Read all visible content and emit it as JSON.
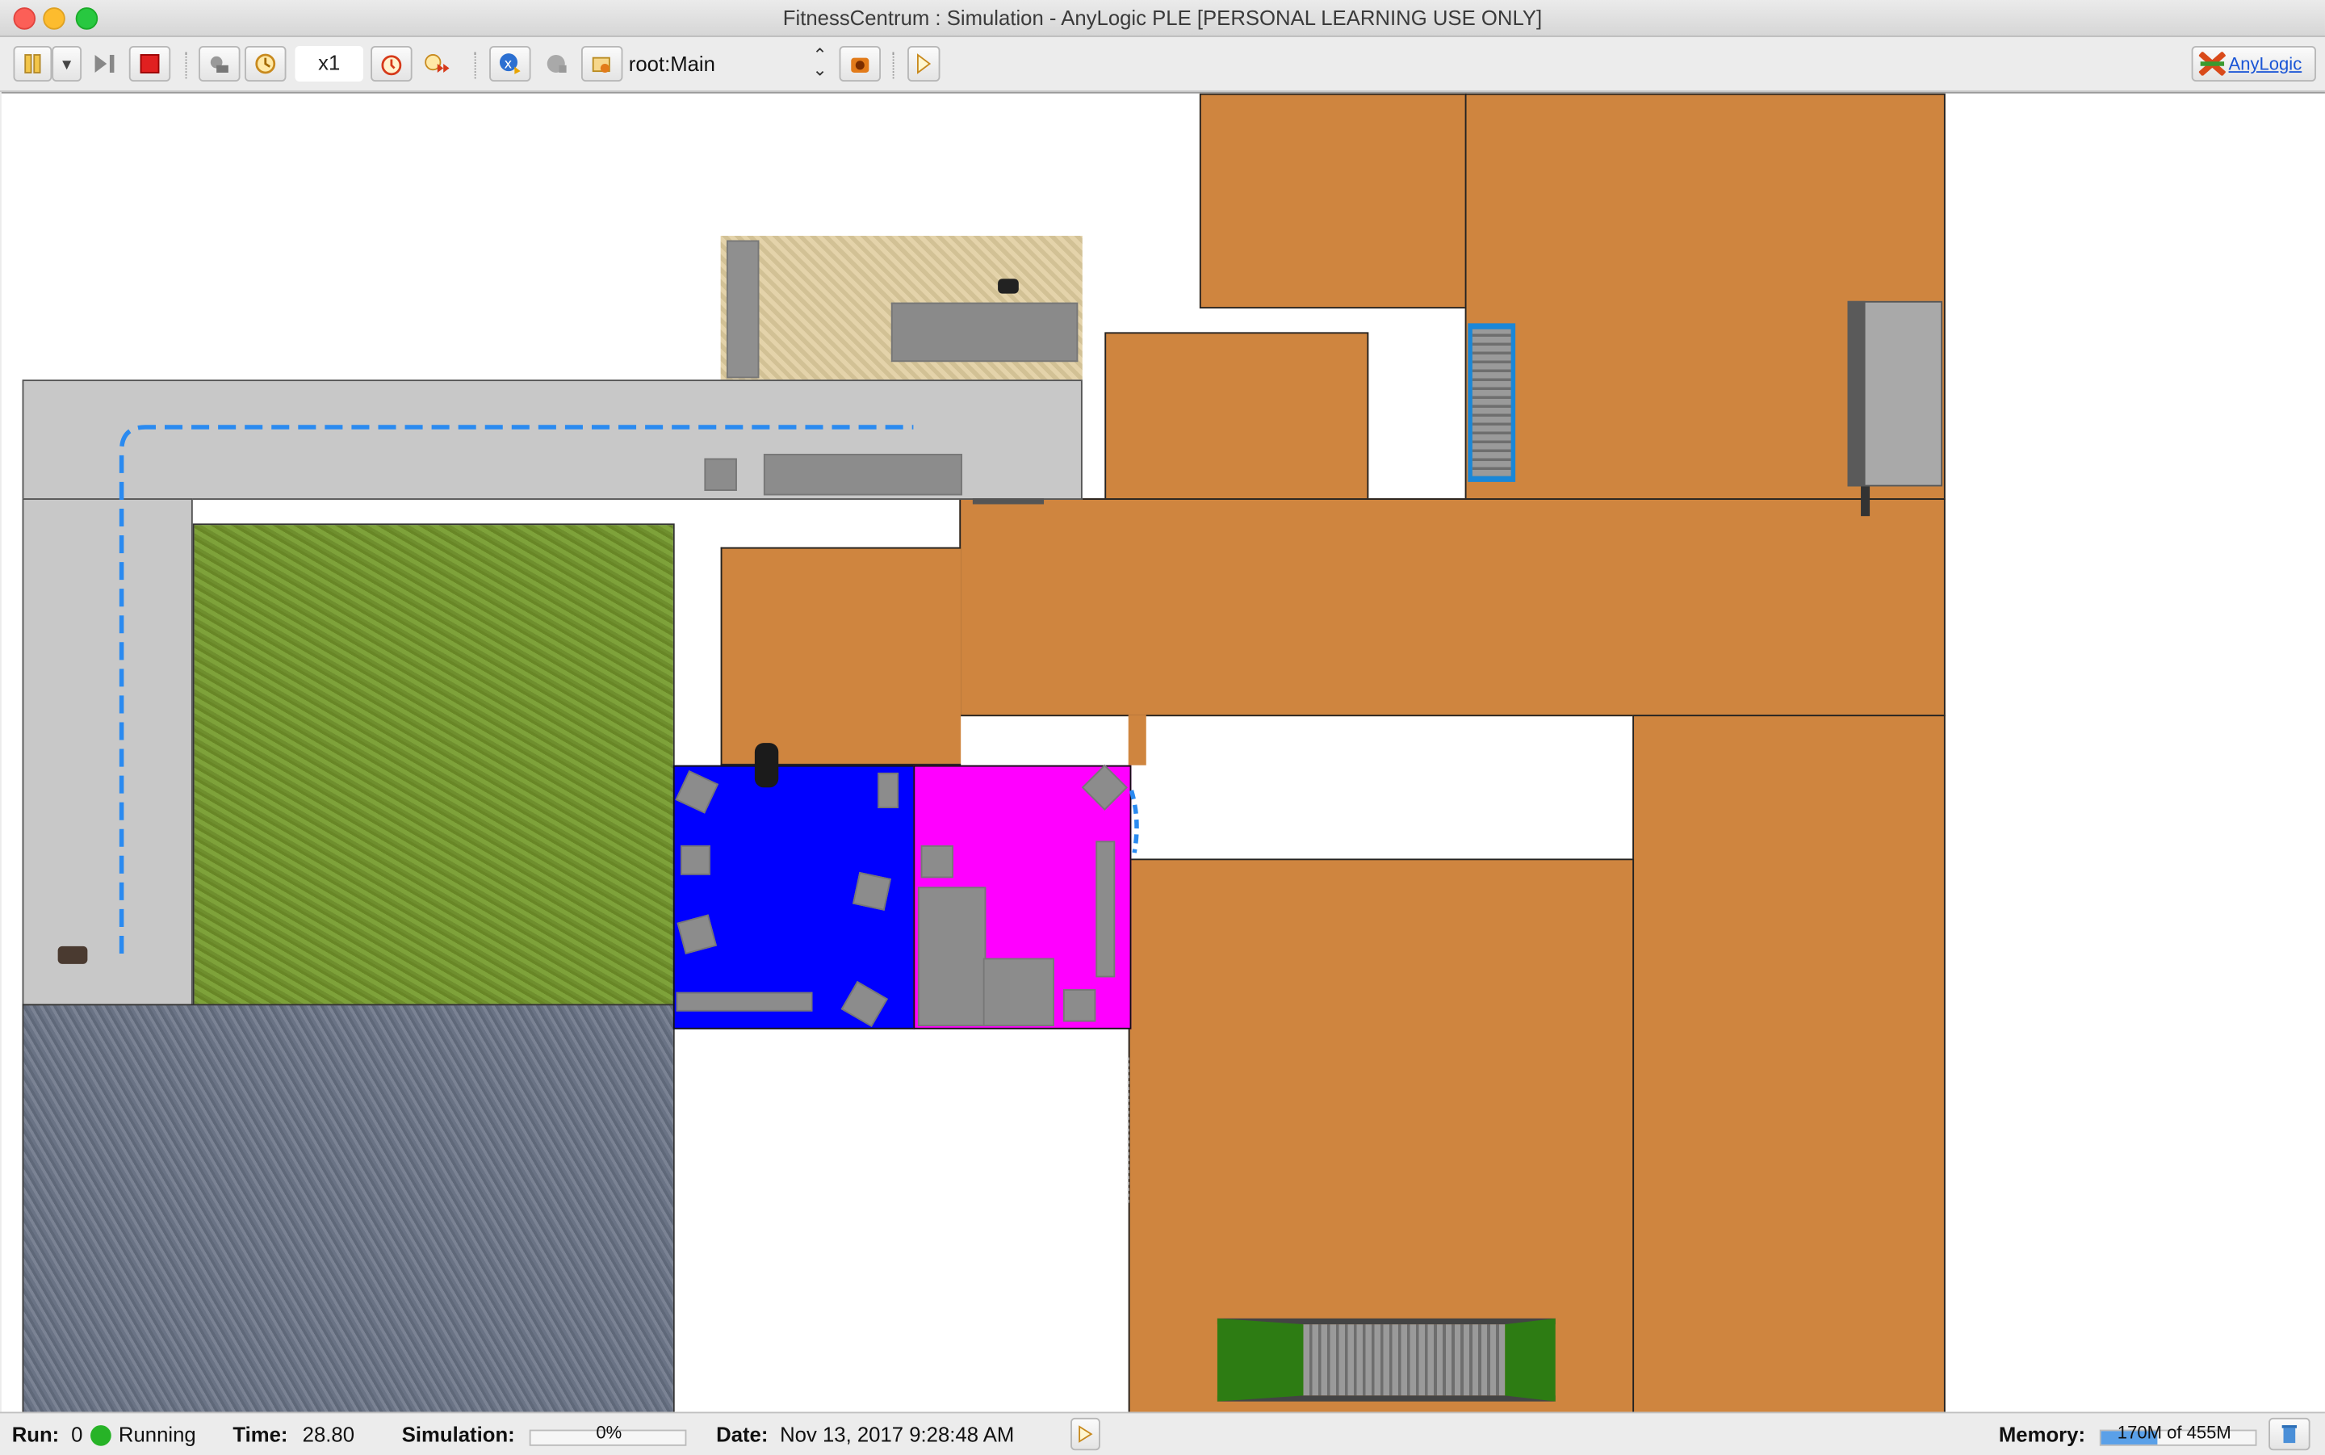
{
  "window": {
    "title": "FitnessCentrum : Simulation - AnyLogic PLE [PERSONAL LEARNING USE ONLY]"
  },
  "toolbar": {
    "speed": "x1",
    "agent_selector": "root:Main",
    "brand_label": "AnyLogic",
    "icons": [
      "pause-icon",
      "dropdown-arrow-icon",
      "step-icon",
      "stop-icon",
      "realtime-icon",
      "virtual-time-icon",
      "speed-up-icon",
      "fast-forward-icon",
      "navigate-root-icon",
      "agent-icon",
      "open-agent-icon",
      "camera-icon",
      "play-experiment-icon",
      "anylogic-logo-icon"
    ]
  },
  "status": {
    "run_label": "Run:",
    "run_value": "0",
    "state": "Running",
    "time_label": "Time:",
    "time_value": "28.80",
    "simulation_label": "Simulation:",
    "simulation_progress": "0%",
    "date_label": "Date:",
    "date_value": "Nov 13, 2017 9:28:48 AM",
    "memory_label": "Memory:",
    "memory_value": "170M of 455M"
  },
  "colors": {
    "floor": "#cf853f",
    "corridor": "#c8c8c8",
    "blue_room": "#0000ff",
    "magenta_room": "#ff00ff",
    "path": "#2a8af0",
    "running_green": "#27b327"
  }
}
